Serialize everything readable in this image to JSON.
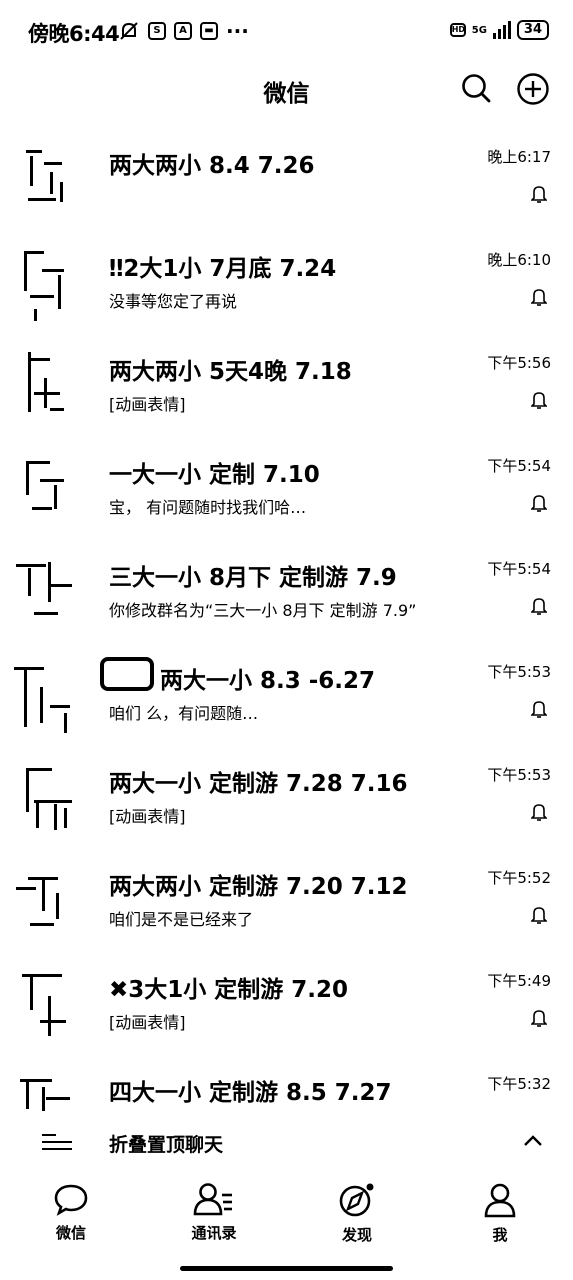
{
  "status_bar": {
    "time": "傍晚6:44",
    "network": "5G",
    "battery": "34"
  },
  "header": {
    "title": "微信"
  },
  "chats": [
    {
      "title": "两大两小              8.4 7.26",
      "preview": "",
      "time": "晚上6:17"
    },
    {
      "title": "‼2大1小 7月底 7.24",
      "preview": "没事等您定了再说",
      "time": "晚上6:10"
    },
    {
      "title": "两大两小 5天4晚 7.18",
      "preview": "[动画表情]",
      "time": "下午5:56"
    },
    {
      "title": "一大一小        定制 7.10",
      "preview": "宝，          有问题随时找我们哈…",
      "time": "下午5:54"
    },
    {
      "title": "三大一小 8月下 定制游 7.9",
      "preview": "你修改群名为“三大一小 8月下 定制游 7.9”",
      "time": "下午5:54"
    },
    {
      "title": "两大一小 8.3 -6.27",
      "preview": "咱们                么，有问题随…",
      "time": "下午5:53"
    },
    {
      "title": "两大一小 定制游 7.28 7.16",
      "preview": "[动画表情]",
      "time": "下午5:53"
    },
    {
      "title": "两大两小 定制游 7.20 7.12",
      "preview": "咱们是不是已经来了",
      "time": "下午5:52"
    },
    {
      "title": "✖3大1小 定制游 7.20",
      "preview": "[动画表情]",
      "time": "下午5:49"
    },
    {
      "title": "四大一小 定制游 8.5 7.27",
      "preview": "",
      "time": "下午5:32"
    }
  ],
  "fold": {
    "label": "折叠置顶聊天"
  },
  "tabs": [
    {
      "label": "微信",
      "icon": "chat-bubble-icon"
    },
    {
      "label": "通讯录",
      "icon": "contacts-icon"
    },
    {
      "label": "发现",
      "icon": "compass-icon"
    },
    {
      "label": "我",
      "icon": "person-icon"
    }
  ]
}
